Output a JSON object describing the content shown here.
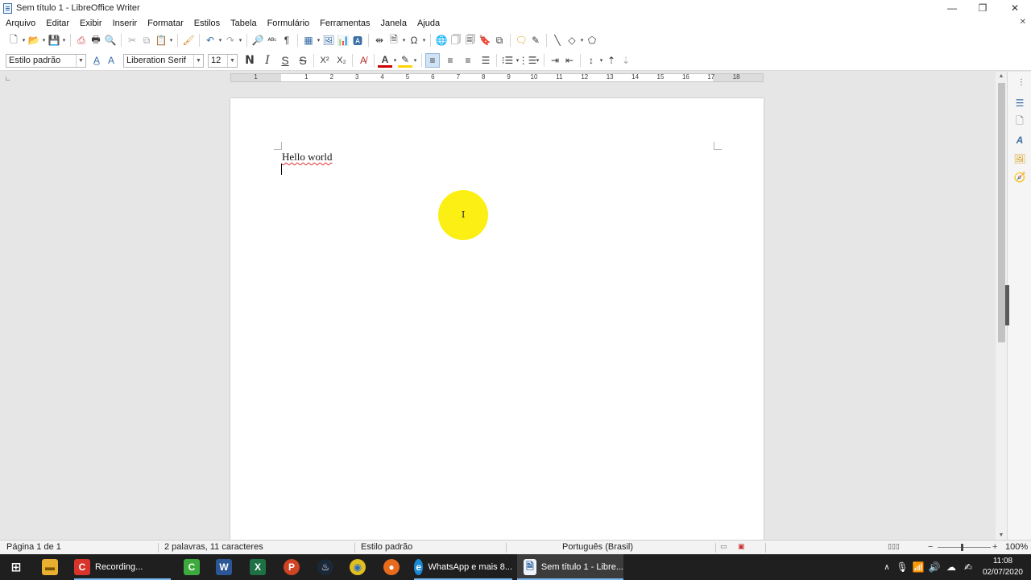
{
  "window": {
    "title": "Sem título 1 - LibreOffice Writer",
    "minimize_glyph": "—",
    "restore_glyph": "❐",
    "close_glyph": "✕"
  },
  "menu": [
    "Arquivo",
    "Editar",
    "Exibir",
    "Inserir",
    "Formatar",
    "Estilos",
    "Tabela",
    "Formulário",
    "Ferramentas",
    "Janela",
    "Ajuda"
  ],
  "formatting": {
    "paragraph_style": "Estilo padrão",
    "font_name": "Liberation Serif",
    "font_size": "12",
    "bold_glyph": "N",
    "italic_glyph": "I",
    "underline_glyph": "S",
    "strike_glyph": "S",
    "superscript_glyph": "X²",
    "subscript_glyph": "X₂",
    "font_color": "#cc0000",
    "highlight_color": "#ffd400"
  },
  "ruler": {
    "numbers": [
      "1",
      "1",
      "2",
      "3",
      "4",
      "5",
      "6",
      "7",
      "8",
      "9",
      "10",
      "11",
      "12",
      "13",
      "14",
      "15",
      "16",
      "17",
      "18"
    ]
  },
  "document": {
    "text": "Hello world"
  },
  "statusbar": {
    "page": "Página 1 de 1",
    "word_count": "2 palavras, 11 caracteres",
    "style": "Estilo padrão",
    "language": "Português (Brasil)",
    "zoom": "100%"
  },
  "taskbar": {
    "items": [
      {
        "label": "Recording..."
      },
      {
        "label": "WhatsApp e mais 8..."
      },
      {
        "label": "Sem título 1 - Libre..."
      }
    ],
    "time": "11:08",
    "date": "02/07/2020"
  }
}
